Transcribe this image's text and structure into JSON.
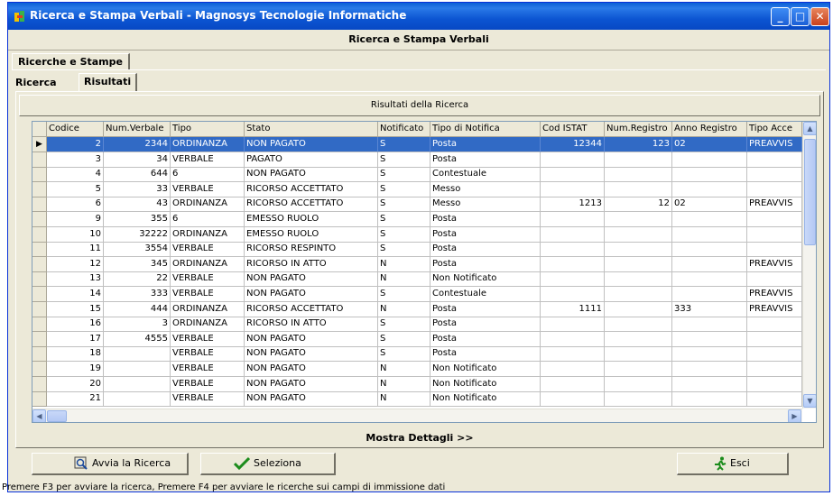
{
  "window": {
    "title": "Ricerca e Stampa Verbali  -  Magnosys Tecnologie Informatiche",
    "buttons": {
      "minimize": "_",
      "maximize": "□",
      "close": "✕"
    }
  },
  "form_header": "Ricerca e Stampa Verbali",
  "outer_tab": "Ricerche e Stampe",
  "inner_tabs": {
    "search": "Ricerca",
    "results": "Risultati"
  },
  "results_title": "Risultati della Ricerca",
  "grid": {
    "columns": [
      "Codice",
      "Num.Verbale",
      "Tipo",
      "Stato",
      "Notificato",
      "Tipo di Notifica",
      "Cod ISTAT",
      "Num.Registro",
      "Anno Registro",
      "Tipo Acce"
    ],
    "rows": [
      [
        "2",
        "2344",
        "ORDINANZA",
        "NON PAGATO",
        "S",
        "Posta",
        "12344",
        "123",
        "02",
        "PREAVVIS"
      ],
      [
        "3",
        "34",
        "VERBALE",
        "PAGATO",
        "S",
        "Posta",
        "",
        "",
        "",
        ""
      ],
      [
        "4",
        "644",
        "6",
        "NON PAGATO",
        "S",
        "Contestuale",
        "",
        "",
        "",
        ""
      ],
      [
        "5",
        "33",
        "VERBALE",
        "RICORSO ACCETTATO",
        "S",
        "Messo",
        "",
        "",
        "",
        ""
      ],
      [
        "6",
        "43",
        "ORDINANZA",
        "RICORSO ACCETTATO",
        "S",
        "Messo",
        "1213",
        "12",
        "02",
        "PREAVVIS"
      ],
      [
        "9",
        "355",
        "6",
        "EMESSO RUOLO",
        "S",
        "Posta",
        "",
        "",
        "",
        ""
      ],
      [
        "10",
        "32222",
        "ORDINANZA",
        "EMESSO RUOLO",
        "S",
        "Posta",
        "",
        "",
        "",
        ""
      ],
      [
        "11",
        "3554",
        "VERBALE",
        "RICORSO RESPINTO",
        "S",
        "Posta",
        "",
        "",
        "",
        ""
      ],
      [
        "12",
        "345",
        "ORDINANZA",
        "RICORSO IN ATTO",
        "N",
        "Posta",
        "",
        "",
        "",
        "PREAVVIS"
      ],
      [
        "13",
        "22",
        "VERBALE",
        "NON PAGATO",
        "N",
        "Non Notificato",
        "",
        "",
        "",
        ""
      ],
      [
        "14",
        "333",
        "VERBALE",
        "NON PAGATO",
        "S",
        "Contestuale",
        "",
        "",
        "",
        "PREAVVIS"
      ],
      [
        "15",
        "444",
        "ORDINANZA",
        "RICORSO ACCETTATO",
        "N",
        "Posta",
        "1111",
        "",
        "333",
        "PREAVVIS"
      ],
      [
        "16",
        "3",
        "ORDINANZA",
        "RICORSO IN ATTO",
        "S",
        "Posta",
        "",
        "",
        "",
        ""
      ],
      [
        "17",
        "4555",
        "VERBALE",
        "NON PAGATO",
        "S",
        "Posta",
        "",
        "",
        "",
        ""
      ],
      [
        "18",
        "",
        "VERBALE",
        "NON PAGATO",
        "S",
        "Posta",
        "",
        "",
        "",
        ""
      ],
      [
        "19",
        "",
        "VERBALE",
        "NON PAGATO",
        "N",
        "Non Notificato",
        "",
        "",
        "",
        ""
      ],
      [
        "20",
        "",
        "VERBALE",
        "NON PAGATO",
        "N",
        "Non Notificato",
        "",
        "",
        "",
        ""
      ],
      [
        "21",
        "",
        "VERBALE",
        "NON PAGATO",
        "N",
        "Non Notificato",
        "",
        "",
        "",
        ""
      ]
    ],
    "selected_row": 0,
    "current_row_marker": "▶"
  },
  "details_button": "Mostra Dettagli >>",
  "buttons": {
    "search": "Avvia la Ricerca",
    "select": "Seleziona",
    "exit": "Esci"
  },
  "status_bar": "Premere F3 per avviare la ricerca, Premere F4 per avviare le ricerche sui campi di immissione dati",
  "colors": {
    "titlebar": "#0a5fd6",
    "selection": "#316ac5",
    "face": "#ece9d8"
  },
  "icons": {
    "app": "app-icon",
    "search": "magnifier-icon",
    "select": "checkmark-icon",
    "exit": "running-man-icon"
  }
}
